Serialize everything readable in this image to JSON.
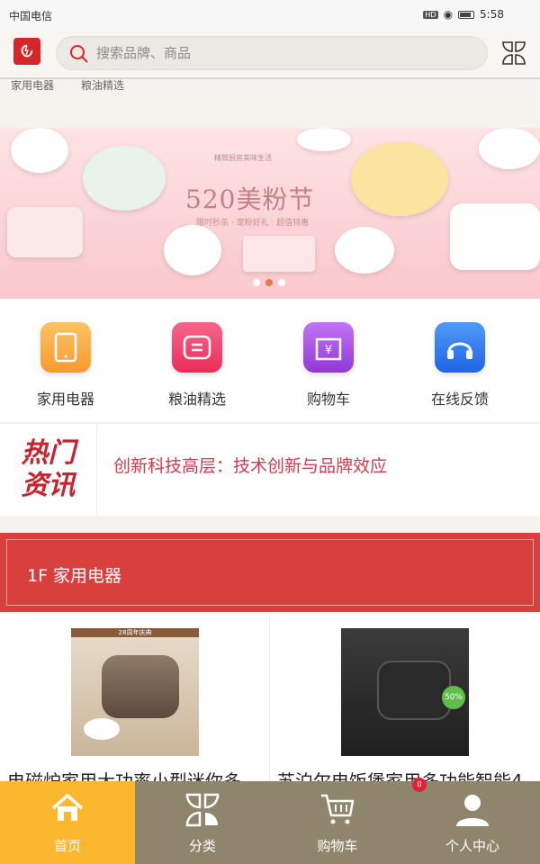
{
  "status_bar": {
    "carrier": "中国电信",
    "badge": "HD",
    "time": "5:58"
  },
  "search": {
    "placeholder": "搜索品牌、商品"
  },
  "sub_nav": [
    "家用电器",
    "粮油精选"
  ],
  "banner": {
    "title": "520美粉节",
    "top_tag": "精致厨房美味生活",
    "subtitle": "限时秒杀 · 宠粉好礼 · 超值特惠",
    "slides": 3,
    "active_slide": 2
  },
  "quick_links": [
    {
      "label": "家用电器",
      "icon": "phone-icon",
      "color": "#f9a840"
    },
    {
      "label": "粮油精选",
      "icon": "list-icon",
      "color": "#f0466a"
    },
    {
      "label": "购物车",
      "icon": "yen-icon",
      "color": "#a248e0"
    },
    {
      "label": "在线反馈",
      "icon": "headphones-icon",
      "color": "#2f7cf0"
    }
  ],
  "news": {
    "badge_line1": "热门",
    "badge_line2": "资讯",
    "headline": "创新科技高层：技术创新与品牌效应"
  },
  "floor": {
    "label": "1F 家用电器"
  },
  "products": [
    {
      "name": "电磁炉家用大功率小型迷你多",
      "img_tag": "28周年庆典"
    },
    {
      "name": "苏泊尔电饭煲家用多功能智能4",
      "img_tag": "50%"
    }
  ],
  "tabbar": [
    {
      "label": "首页",
      "icon": "home-icon",
      "active": true
    },
    {
      "label": "分类",
      "icon": "category-icon",
      "active": false
    },
    {
      "label": "购物车",
      "icon": "cart-icon",
      "active": false
    },
    {
      "label": "个人中心",
      "icon": "user-icon",
      "active": false
    }
  ],
  "cart_badge": "0",
  "colors": {
    "accent": "#fbb72e",
    "tabbar": "#8f856c",
    "floor": "#d8403d",
    "brand": "#d5272b"
  }
}
